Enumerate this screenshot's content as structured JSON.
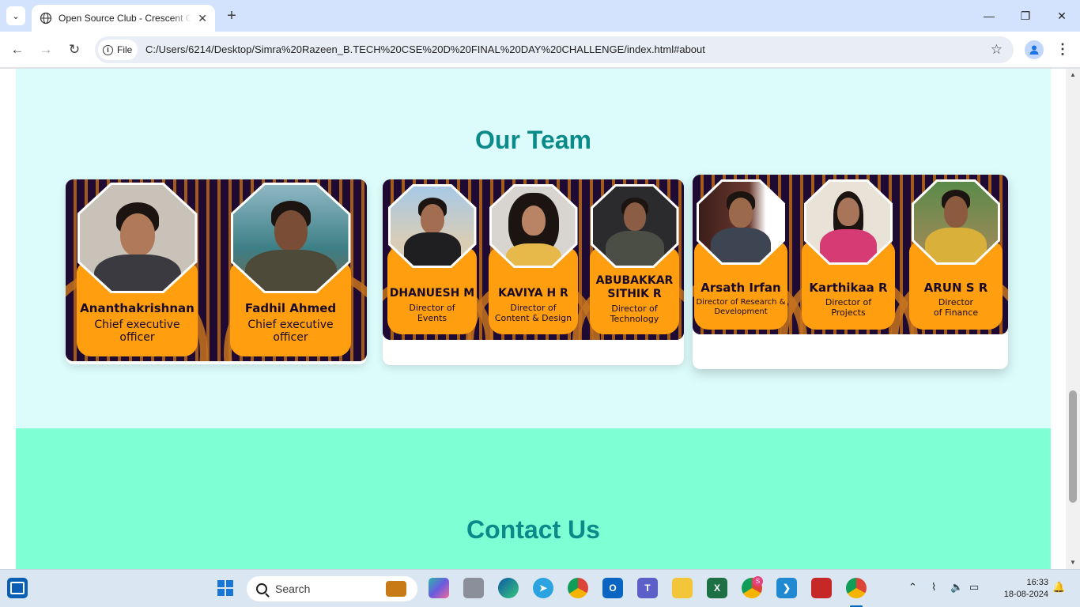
{
  "browser": {
    "tab_title": "Open Source Club - Crescent College",
    "tab_close": "✕",
    "new_tab": "+",
    "file_chip": "File",
    "url": "C:/Users/6214/Desktop/Simra%20Razeen_B.TECH%20CSE%20D%20FINAL%20DAY%20CHALLENGE/index.html#about",
    "window_controls": [
      "—",
      "❐",
      "✕"
    ]
  },
  "page": {
    "team_heading": "Our Team",
    "contact_heading": "Contact Us",
    "colors": {
      "heading": "#0b8a8a",
      "team_bg": "#dcfcfb",
      "contact_bg": "#7fffd4",
      "plate": "#ff9f0f",
      "banner": "#1e0a33"
    },
    "cards": [
      {
        "members": [
          {
            "name": "Ananthakrishnan",
            "role": "Chief executive officer"
          },
          {
            "name": "Fadhil Ahmed",
            "role": "Chief executive officer"
          }
        ]
      },
      {
        "members": [
          {
            "name": "DHANUESH M",
            "role": "Director of Events"
          },
          {
            "name": "KAVIYA H R",
            "role": "Director of Content & Design"
          },
          {
            "name": "ABUBAKKAR SITHIK R",
            "role": "Director of Technology"
          }
        ]
      },
      {
        "members": [
          {
            "name": "Arsath Irfan",
            "role": "Director of  Research & Development"
          },
          {
            "name": "Karthikaa R",
            "role": "Director of Projects"
          },
          {
            "name": "ARUN S R",
            "role": "Director of Finance"
          }
        ]
      }
    ]
  },
  "taskbar": {
    "search_placeholder": "Search",
    "time": "16:33",
    "date": "18-08-2024",
    "apps": [
      "windows-start",
      "copilot-pre",
      "task-view",
      "edge",
      "telegram",
      "chrome",
      "outlook",
      "teams",
      "file-explorer",
      "excel",
      "chrome-profile-s",
      "vscode",
      "app-red",
      "chrome-active"
    ],
    "chrome_badge": "S"
  }
}
